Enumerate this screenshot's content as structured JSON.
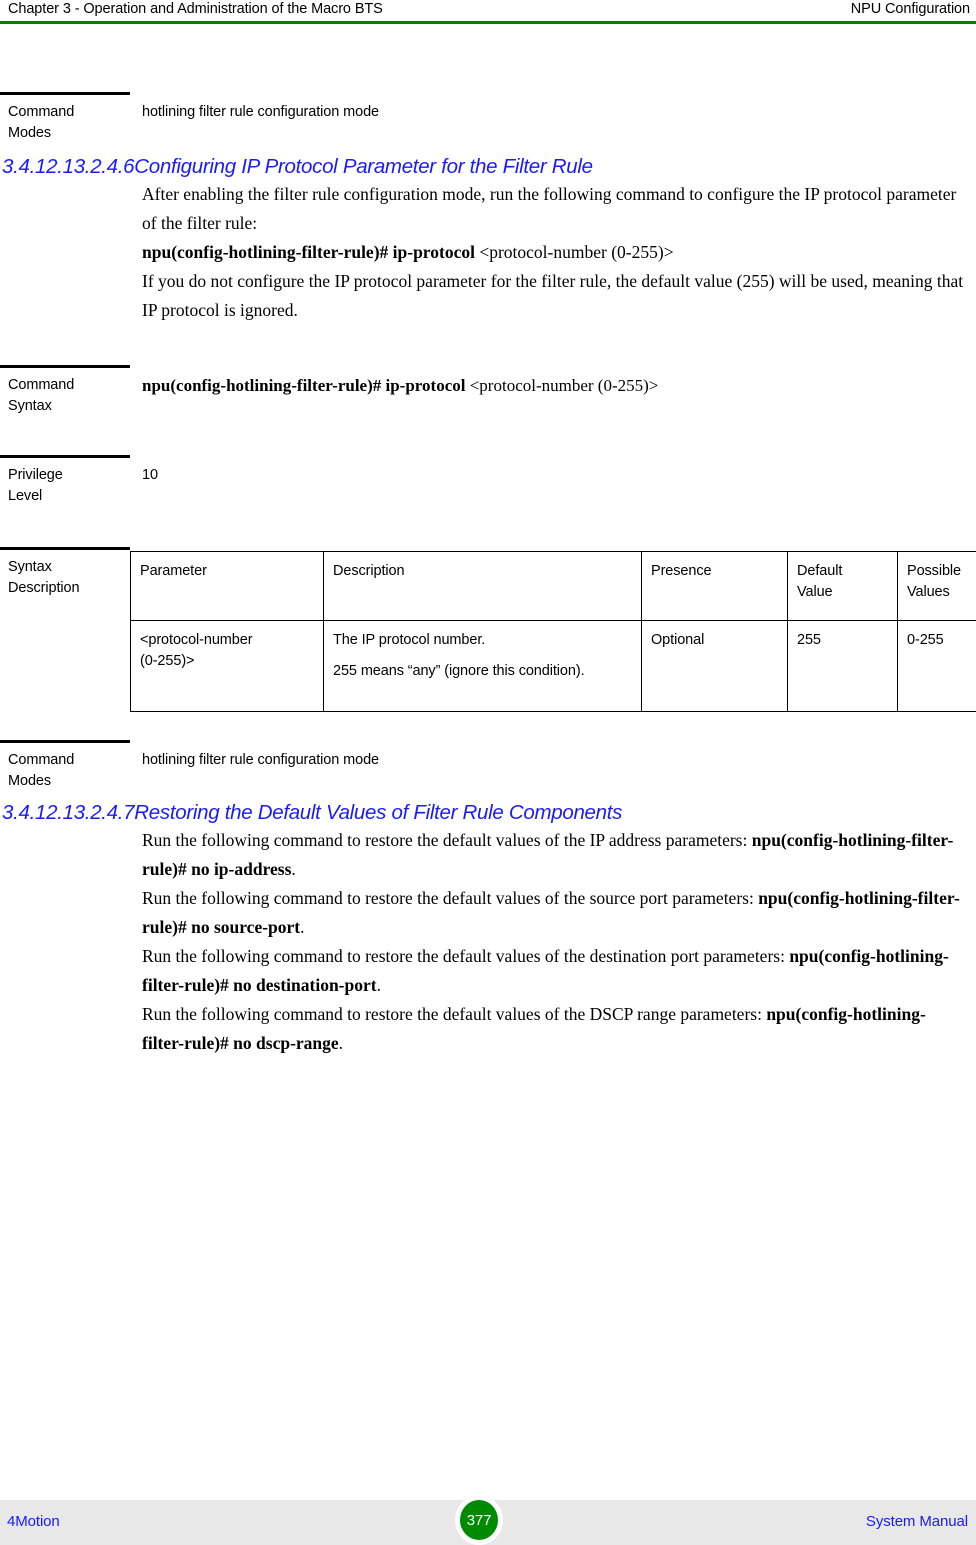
{
  "header": {
    "left": "Chapter 3 - Operation and Administration of the Macro BTS",
    "right": "NPU Configuration",
    "rule_color": "#0a7a0a"
  },
  "blocks": {
    "command_modes_label_line1": "Command",
    "command_modes_label_line2": "Modes",
    "command_modes_value_top": "hotlining filter rule configuration mode",
    "command_syntax_label_line1": "Command",
    "command_syntax_label_line2": "Syntax",
    "privilege_label_line1": "Privilege",
    "privilege_label_line2": "Level",
    "privilege_value": "10",
    "syntax_description_label_line1": "Syntax",
    "syntax_description_label_line2": "Description",
    "command_modes_value_bottom": "hotlining filter rule configuration mode"
  },
  "section1": {
    "heading": "3.4.12.13.2.4.6Configuring IP Protocol Parameter for the Filter Rule",
    "para1": "After enabling the filter rule configuration mode, run the following command to configure the IP protocol parameter of the filter rule:",
    "command_bold": "npu(config-hotlining-filter-rule)# ip-protocol",
    "command_arg": "<protocol-number (0-255)>",
    "para2": "If you do not configure the IP protocol parameter for the filter rule, the default value (255) will be used, meaning that IP protocol is ignored.",
    "syntax_bold": "npu(config-hotlining-filter-rule)# ip-protocol",
    "syntax_arg": "<protocol-number (0-255)>"
  },
  "param_table": {
    "headers": [
      "Parameter",
      "Description",
      "Presence",
      "Default Value",
      "Possible Values"
    ],
    "header_default_line1": "Default",
    "header_default_line2": "Value",
    "header_possible_line1": "Possible",
    "header_possible_line2": "Values",
    "rows": [
      {
        "parameter_line1": "<protocol-number",
        "parameter_line2": "(0-255)>",
        "description_line1": "The IP protocol number.",
        "description_line2": "255 means “any” (ignore this condition).",
        "presence": "Optional",
        "default_value": "255",
        "possible_values": "0-255"
      }
    ]
  },
  "section2": {
    "heading": "3.4.12.13.2.4.7Restoring the Default Values of Filter Rule Components",
    "items": [
      {
        "text": "Run the following command to restore the default values of the IP address parameters: ",
        "command": "npu(config-hotlining-filter-rule)# no ip-address",
        "period": "."
      },
      {
        "text": "Run the following command to restore the default values of the source port parameters: ",
        "command": "npu(config-hotlining-filter-rule)# no source-port",
        "period": "."
      },
      {
        "text": "Run the following command to restore the default values of the destination port parameters: ",
        "command": "npu(config-hotlining-filter-rule)# no destination-port",
        "period": "."
      },
      {
        "text": "Run the following command to restore the default values of the DSCP range parameters: ",
        "command": "npu(config-hotlining-filter-rule)# no dscp-range",
        "period": "."
      }
    ]
  },
  "footer": {
    "left": "4Motion",
    "page_number": "377",
    "right": "System Manual",
    "badge_color": "#008a00",
    "band_color": "#e8e8e8",
    "link_color": "#1a1aff"
  }
}
